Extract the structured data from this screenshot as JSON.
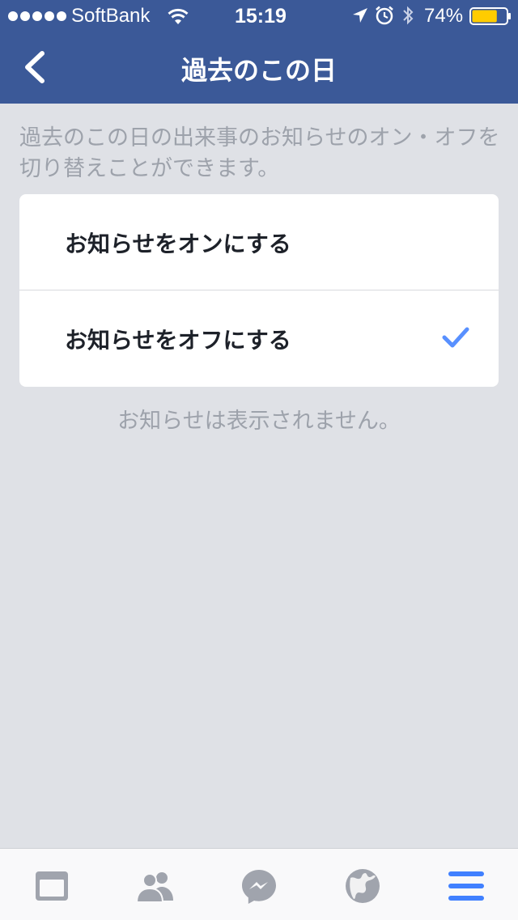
{
  "status_bar": {
    "carrier": "SoftBank",
    "time": "15:19",
    "battery": "74%",
    "battery_level": 0.74,
    "icons": [
      "signal-icon",
      "wifi-icon",
      "location-icon",
      "alarm-icon",
      "bluetooth-icon",
      "battery-icon"
    ]
  },
  "nav": {
    "title": "過去のこの日",
    "back_icon": "chevron-left-icon"
  },
  "main": {
    "description": "過去のこの日の出来事のお知らせのオン・オフを切り替えことができます。",
    "options": [
      {
        "label": "お知らせをオンにする",
        "selected": false
      },
      {
        "label": "お知らせをオフにする",
        "selected": true
      }
    ],
    "footer_note": "お知らせは表示されません。"
  },
  "tabbar": {
    "tabs": [
      "news-feed-icon",
      "friends-icon",
      "messenger-icon",
      "globe-icon",
      "menu-icon"
    ]
  },
  "colors": {
    "brand": "#3b5998",
    "accent": "#5890ff",
    "tab_inactive": "#a0a4ad",
    "tab_active": "#4080ff"
  }
}
